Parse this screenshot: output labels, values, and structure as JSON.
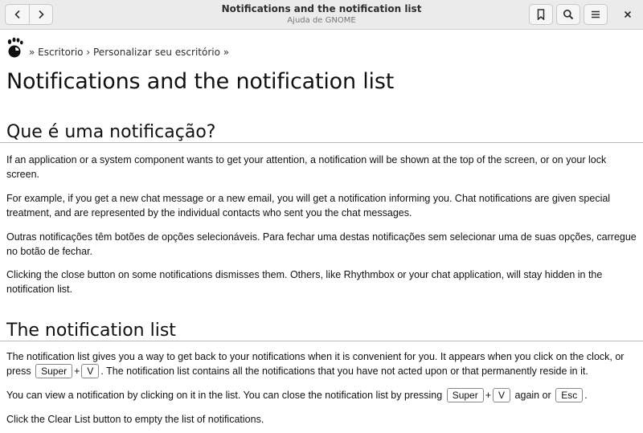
{
  "window": {
    "title": "Notifications and the notification list",
    "subtitle": "Ajuda de GNOME"
  },
  "icons": {
    "back": "chevron-left-icon",
    "forward": "chevron-right-icon",
    "bookmark": "bookmark-icon",
    "search": "search-icon",
    "menu": "hamburger-menu-icon",
    "close": "close-icon",
    "logo": "gnome-foot-logo"
  },
  "breadcrumb": {
    "sep_start": "»",
    "item1": "Escritorio",
    "sep_mid": "›",
    "item2": "Personalizar seu escritório",
    "sep_end": "»"
  },
  "page": {
    "title": "Notifications and the notification list",
    "section1": {
      "heading": "Que é uma notificação?",
      "p1": "If an application or a system component wants to get your attention, a notification will be shown at the top of the screen, or on your lock screen.",
      "p2": "For example, if you get a new chat message or a new email, you will get a notification informing you. Chat notifications are given special treatment, and are represented by the individual contacts who sent you the chat messages.",
      "p3": "Outras notificações têm botões de opções selecionáveis. Para fechar uma destas notificações sem selecionar uma de suas opções, carregue no botão de fechar.",
      "p4": "Clicking the close button on some notifications dismisses them. Others, like Rhythmbox or your chat application, will stay hidden in the notification list."
    },
    "section2": {
      "heading": "The notification list",
      "p1_a": "The notification list gives you a way to get back to your notifications when it is convenient for you. It appears when you click on the clock, or press",
      "p1_key1": "Super",
      "p1_plus": "+",
      "p1_key2": "V",
      "p1_b": ". The notification list contains all the notifications that you have not acted upon or that permanently reside in it.",
      "p2_a": "You can view a notification by clicking on it in the list. You can close the notification list by pressing",
      "p2_key1": "Super",
      "p2_plus": "+",
      "p2_key2": "V",
      "p2_again": "again or",
      "p2_key3": "Esc",
      "p2_end": ".",
      "p3": "Click the Clear List button to empty the list of notifications."
    }
  },
  "colors": {
    "headerbar_bg": "#ebebeb",
    "text": "#111111",
    "rule": "#b8b8b8"
  }
}
